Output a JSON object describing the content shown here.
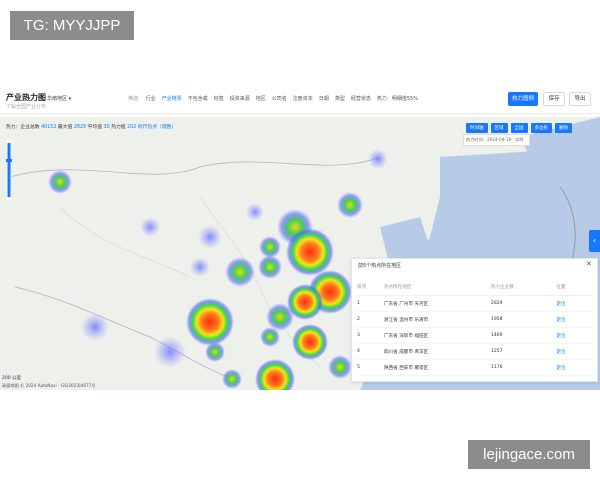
{
  "watermark_top": "TG: MYYJJPP",
  "watermark_bottom": "lejingace.com",
  "header": {
    "title": "产业热力图",
    "subtitle": "了解全国产业分布",
    "region": "华南地区",
    "filter_label": "筛选:",
    "filters": [
      "行业",
      "产业链票",
      "不包含或",
      "标签",
      "投资来源",
      "地区",
      "公司名",
      "注册资本",
      "日期",
      "类型",
      "经营状态",
      "热力：明细值55%"
    ],
    "active_filter_index": 1,
    "btn_heatmap": "热力图例",
    "btn_save": "保存",
    "btn_export": "导出"
  },
  "stats": {
    "label_total": "热力：企业总数",
    "total": "40152",
    "label_max": "最大值",
    "max": "2829",
    "label_avg": "平均值",
    "avg": "30",
    "label_heat": "热力值",
    "heat": "202",
    "extra": "标尺热点（调整）"
  },
  "toolbar": [
    "时间轴",
    "区域",
    "全国",
    "多边形",
    "删除"
  ],
  "date_chip": "热力时间：2024-04-19 · 实时",
  "panel": {
    "title": "前5个热点所在地区",
    "columns": [
      "排序",
      "热点所在地区",
      "热力企业数",
      "位置"
    ],
    "rows": [
      {
        "rank": "1",
        "region": "广东省 广州市 天河区",
        "count": "2829",
        "action": "定位"
      },
      {
        "rank": "2",
        "region": "浙江省 温州市 乐清市",
        "count": "1958",
        "action": "定位"
      },
      {
        "rank": "3",
        "region": "广东省 深圳市 福田区",
        "count": "1469",
        "action": "定位"
      },
      {
        "rank": "4",
        "region": "四川省 成都市 青羊区",
        "count": "1257",
        "action": "定位"
      },
      {
        "rank": "5",
        "region": "陕西省 西安市 雁塔区",
        "count": "1176",
        "action": "定位"
      }
    ]
  },
  "scale_text": "200 公里",
  "copyright": "高德地图  © 2024 AutoNavi - GS(2023)4677号"
}
